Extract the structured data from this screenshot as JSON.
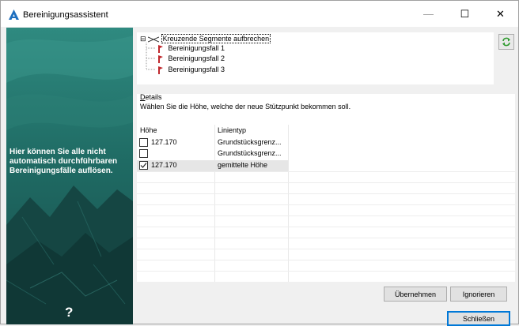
{
  "window": {
    "title": "Bereinigungsassistent",
    "minimize": "—",
    "maximize": "☐",
    "close": "✕"
  },
  "sidebar": {
    "info_text": "Hier können Sie alle nicht automatisch durchführbaren Bereinigungsfälle auflösen.",
    "help": "?"
  },
  "tree": {
    "root": {
      "label": "Kreuzende Segmente aufbrechen",
      "expander": "⊟"
    },
    "children": [
      {
        "label": "Bereinigungsfall 1"
      },
      {
        "label": "Bereinigungsfall 2"
      },
      {
        "label": "Bereinigungsfall 3"
      }
    ]
  },
  "refresh_icon": "refresh-icon",
  "details": {
    "legend": "Details",
    "legend_accel": "D",
    "legend_rest": "etails",
    "instruction": "Wählen Sie die Höhe, welche der neue Stützpunkt bekommen soll."
  },
  "table": {
    "headers": [
      "Höhe",
      "Linientyp"
    ],
    "rows": [
      {
        "checked": false,
        "hoehe": "127.170",
        "linientyp": "Grundstücksgrenz..."
      },
      {
        "checked": false,
        "hoehe": "",
        "linientyp": "Grundstücksgrenz..."
      },
      {
        "checked": true,
        "hoehe": "127.170",
        "linientyp": "gemittelte Höhe"
      }
    ]
  },
  "buttons": {
    "apply": "Übernehmen",
    "ignore": "Ignorieren",
    "close": "Schließen"
  },
  "colors": {
    "sidebar": "#22645f",
    "accent": "#0078d7",
    "tree_icon": "#c0282d"
  }
}
